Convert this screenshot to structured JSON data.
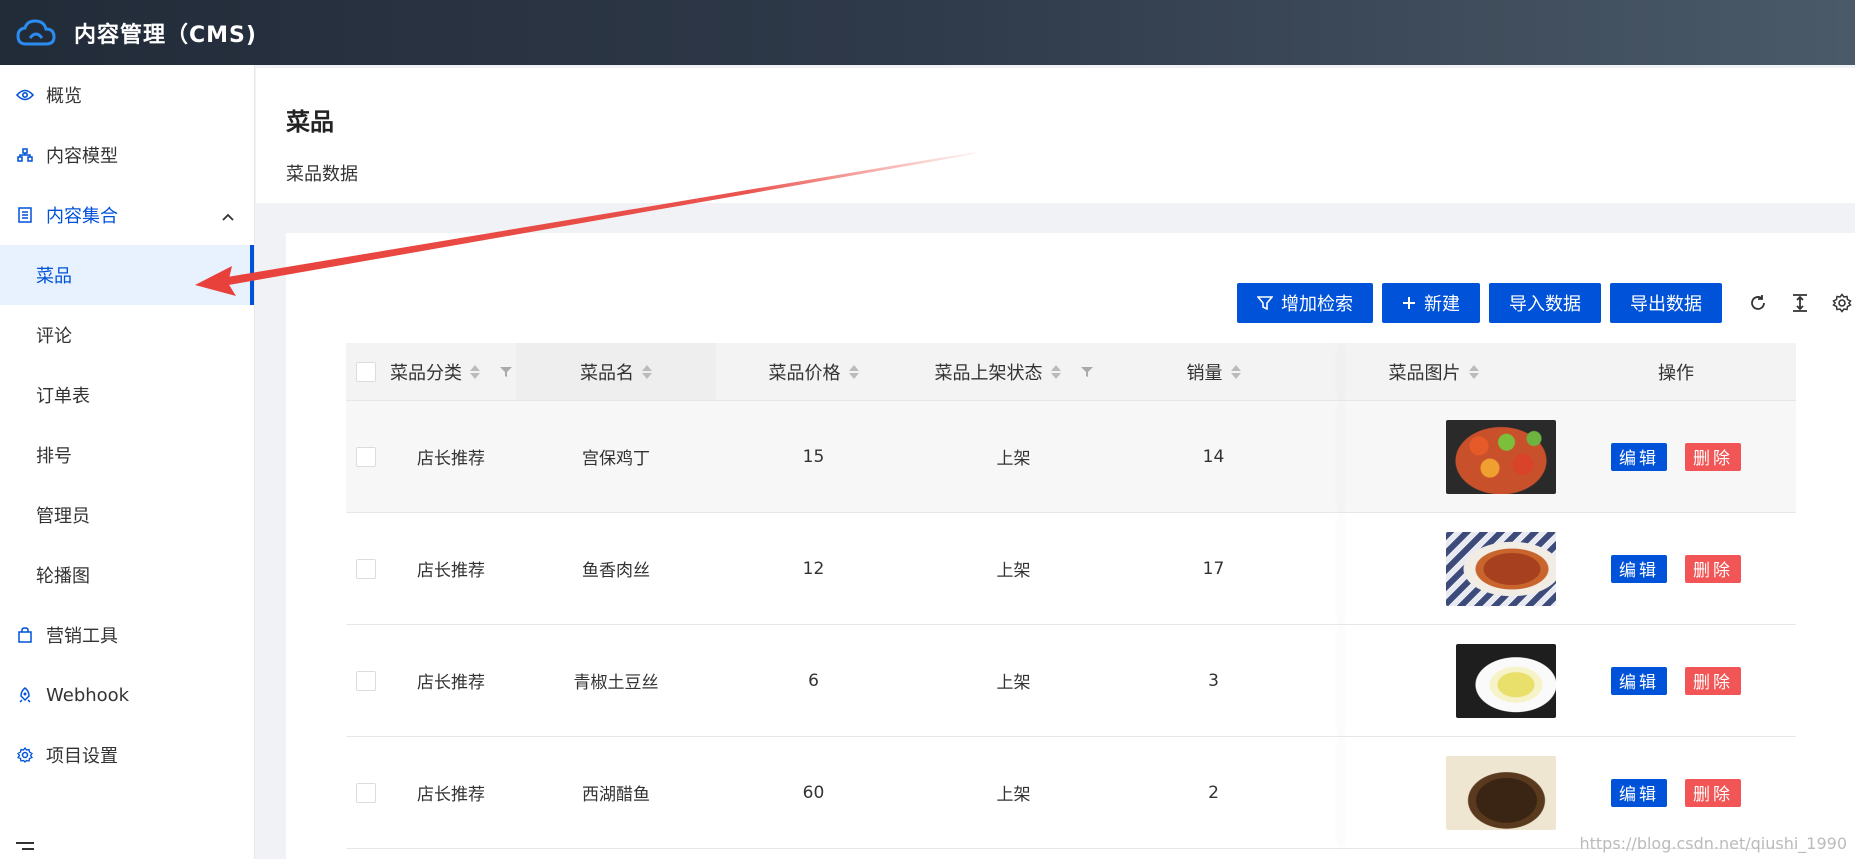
{
  "header": {
    "title": "内容管理（CMS)"
  },
  "sidebar": {
    "items": [
      {
        "label": "概览"
      },
      {
        "label": "内容模型"
      },
      {
        "label": "内容集合"
      },
      {
        "label": "营销工具"
      },
      {
        "label": "Webhook"
      },
      {
        "label": "项目设置"
      }
    ],
    "subitems": [
      {
        "label": "菜品"
      },
      {
        "label": "评论"
      },
      {
        "label": "订单表"
      },
      {
        "label": "排号"
      },
      {
        "label": "管理员"
      },
      {
        "label": "轮播图"
      }
    ]
  },
  "page": {
    "title": "菜品",
    "subtitle": "菜品数据"
  },
  "toolbar": {
    "add_search": "增加检索",
    "new": "新建",
    "import": "导入数据",
    "export": "导出数据"
  },
  "table": {
    "columns": [
      "菜品分类",
      "菜品名",
      "菜品价格",
      "菜品上架状态",
      "销量",
      "菜品图片",
      "操作"
    ],
    "rows": [
      {
        "category": "店长推荐",
        "name": "宫保鸡丁",
        "price": "15",
        "status": "上架",
        "sales": "14"
      },
      {
        "category": "店长推荐",
        "name": "鱼香肉丝",
        "price": "12",
        "status": "上架",
        "sales": "17"
      },
      {
        "category": "店长推荐",
        "name": "青椒土豆丝",
        "price": "6",
        "status": "上架",
        "sales": "3"
      },
      {
        "category": "店长推荐",
        "name": "西湖醋鱼",
        "price": "60",
        "status": "上架",
        "sales": "2"
      }
    ],
    "edit_label": "编辑",
    "delete_label": "删除"
  },
  "watermark": "https://blog.csdn.net/qiushi_1990",
  "colors": {
    "primary": "#0052d9",
    "danger": "#f25555",
    "arrow": "#e8413b"
  }
}
